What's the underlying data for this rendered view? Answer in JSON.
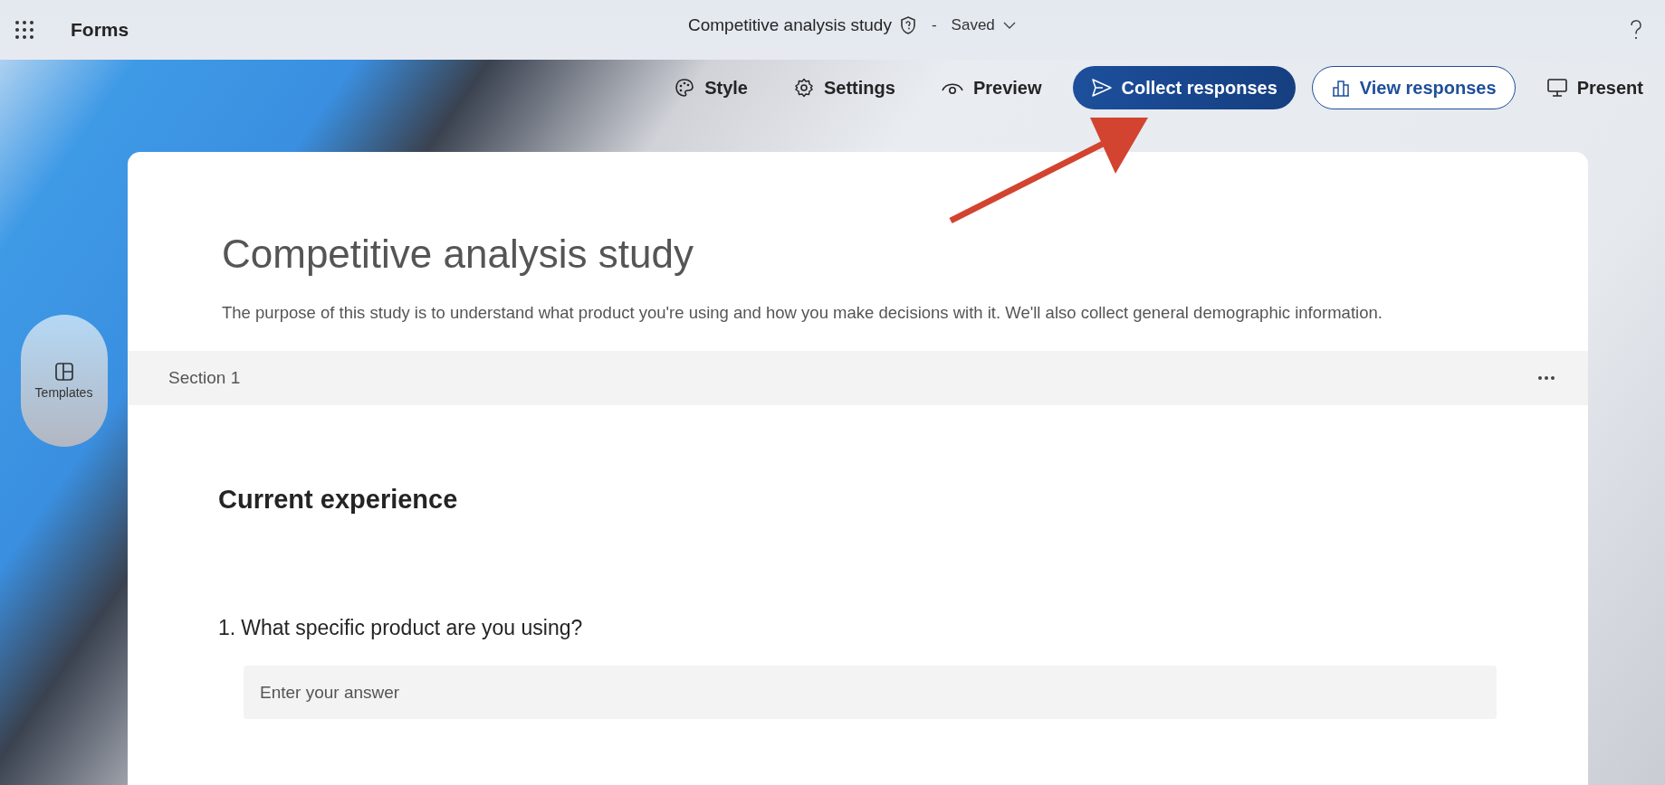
{
  "app": {
    "name": "Forms"
  },
  "header": {
    "title": "Competitive analysis study",
    "separator": "-",
    "status": "Saved"
  },
  "toolbar": [
    {
      "label": "Style",
      "kind": "plain"
    },
    {
      "label": "Settings",
      "kind": "plain"
    },
    {
      "label": "Preview",
      "kind": "plain"
    },
    {
      "label": "Collect responses",
      "kind": "primary"
    },
    {
      "label": "View responses",
      "kind": "outline"
    },
    {
      "label": "Present",
      "kind": "plain"
    }
  ],
  "side_button": {
    "label": "Templates"
  },
  "form": {
    "title": "Competitive analysis study",
    "description": "The purpose of this study is to understand what product you're using and how you make decisions with it. We'll also collect general demographic information.",
    "section": {
      "label": "Section 1",
      "heading": "Current experience",
      "questions": [
        {
          "number": "1.",
          "text": "What specific product are you using?",
          "placeholder": "Enter your answer"
        }
      ]
    }
  }
}
